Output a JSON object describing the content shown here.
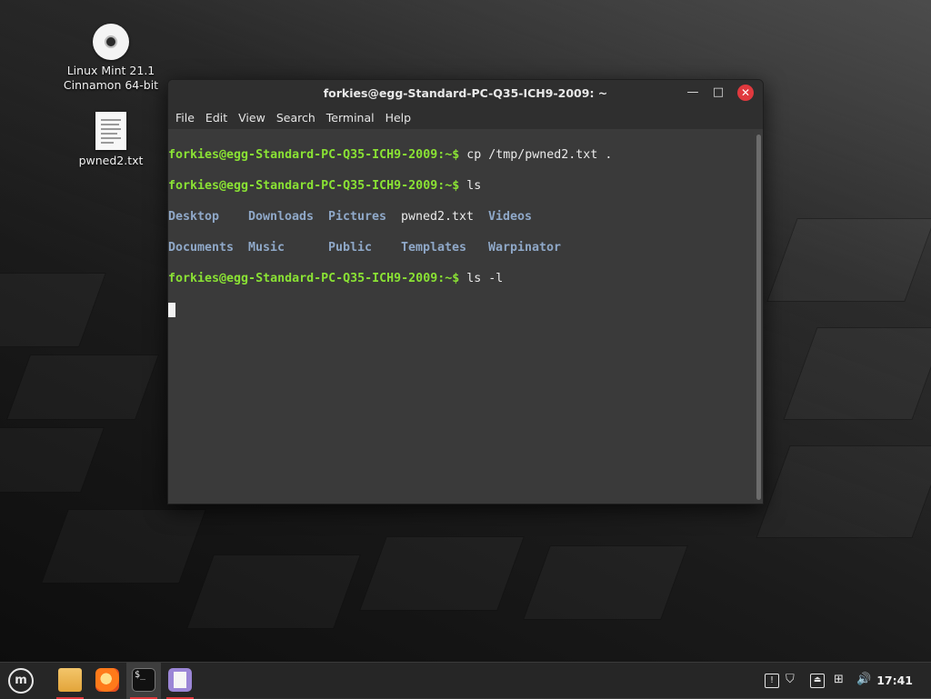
{
  "desktop": {
    "icons": [
      {
        "label_line1": "Linux Mint 21.1",
        "label_line2": "Cinnamon 64-bit",
        "icon": "disc-icon"
      },
      {
        "label_line1": "pwned2.txt",
        "icon": "text-file-icon"
      }
    ]
  },
  "window": {
    "title": "forkies@egg-Standard-PC-Q35-ICH9-2009: ~",
    "controls": {
      "minimize": "—",
      "maximize": "□",
      "close": "✕"
    },
    "menu": [
      "File",
      "Edit",
      "View",
      "Search",
      "Terminal",
      "Help"
    ]
  },
  "terminal": {
    "prompt": "forkies@egg-Standard-PC-Q35-ICH9-2009:~$",
    "line1_cmd": " cp /tmp/pwned2.txt .",
    "line2_cmd": " ls",
    "ls_row1": [
      "Desktop",
      "Downloads",
      "Pictures",
      "pwned2.txt",
      "Videos"
    ],
    "ls_row2": [
      "Documents",
      "Music",
      "Public",
      "Templates",
      "Warpinator"
    ],
    "line5_cmd": " ls -l",
    "colors": {
      "prompt": "#8ae234",
      "directory": "#8fa8c8",
      "file": "#eaeaea",
      "background": "#3a3a3a"
    }
  },
  "taskbar": {
    "menu_icon": "linux-mint-logo-icon",
    "menu_glyph": "m",
    "apps": [
      {
        "name": "files-icon"
      },
      {
        "name": "firefox-icon"
      },
      {
        "name": "terminal-icon",
        "glyph": "$_"
      },
      {
        "name": "text-editor-icon"
      }
    ],
    "tray": {
      "notifications_glyph": "!",
      "update_glyph": "⛉",
      "removable_glyph": "⏏",
      "network_glyph": "⊞",
      "volume_glyph": "🔊"
    },
    "clock": "17:41"
  }
}
